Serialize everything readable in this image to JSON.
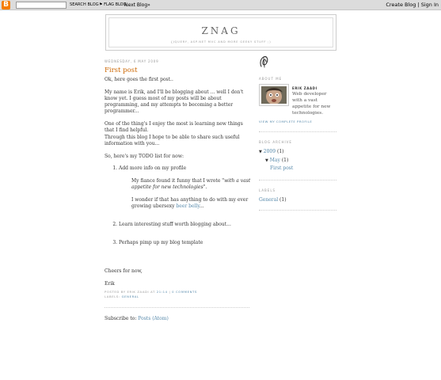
{
  "navbar": {
    "logo_letter": "B",
    "search_button": "SEARCH BLOG",
    "flag_button": "⚑ FLAG BLOG",
    "next_blog": "Next Blog»",
    "create_blog": "Create Blog",
    "sign_in": "Sign In"
  },
  "header": {
    "title": "ZNAG",
    "description": "{jquery, asp.net mvc and more geeky stuff ;)"
  },
  "post": {
    "date": "Wednesday, 6 May 2009",
    "title": "First post",
    "p1": "Ok, here goes the first post..",
    "p2": "My name is Erik, and I'll be blogging about ... well I don't know yet. I guess most of my posts will be about programming, and my attempts to becoming a better programmer...",
    "p3a": "One of the thing's I enjoy the most is learning new things that I find helpful.",
    "p3b": "Through this blog I hope to be able to share such useful information with you...",
    "p4": "So, here's my TODO list for now:",
    "todo": [
      "Add more info on my profile",
      "Learn interesting stuff worth blogging about...",
      "Perhaps pimp up my blog template"
    ],
    "sub1_before": "My fiance found it funny that I wrote \"",
    "sub1_em": "with a vast appetite for new technologies",
    "sub1_after": "\".",
    "sub2_before": "I wonder if that has anything to do with my ever growing ubersexy ",
    "sub2_link": "beer belly",
    "sub2_after": "...",
    "closing": "Cheers for now,",
    "signature": "Erik",
    "footer_posted_by": "Posted by Erik Zaadi at",
    "footer_time": "21:14",
    "footer_divider": "|",
    "footer_comments": "0 comments",
    "footer_labels_label": "Labels:",
    "footer_label": "General"
  },
  "subscribe": {
    "label": "Subscribe to:",
    "link": "Posts (Atom)"
  },
  "sidebar": {
    "about_heading": "About Me",
    "profile_name": "Erik Zaadi",
    "profile_desc": "Web developer with a vast appetite for new technologies.",
    "profile_link": "View my complete profile",
    "archive_heading": "Blog Archive",
    "archive_year_toggle": "▼",
    "archive_year": "2009",
    "archive_year_count": "(1)",
    "archive_month_toggle": "▼",
    "archive_month": "May",
    "archive_month_count": "(1)",
    "archive_post": "First post",
    "labels_heading": "Labels",
    "label_name": "General",
    "label_count": "(1)"
  },
  "colors": {
    "post_title": "#cc6600",
    "link": "#5588aa",
    "navbar": "#dcdcdc",
    "blogger_orange": "#f57d00"
  }
}
